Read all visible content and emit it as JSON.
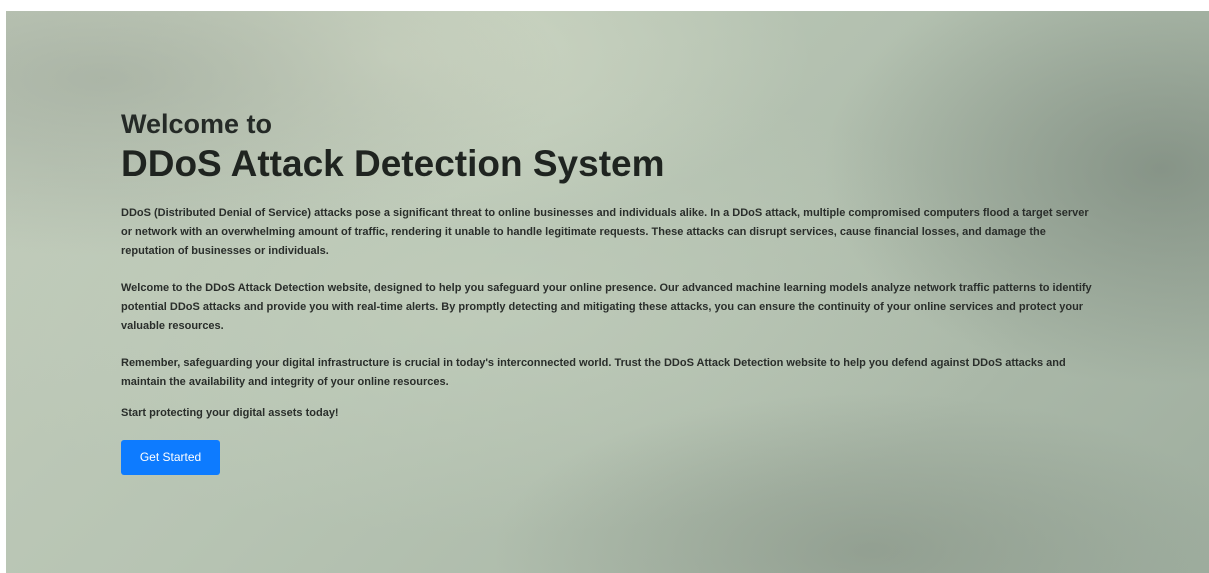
{
  "hero": {
    "welcome": "Welcome to",
    "title": "DDoS Attack Detection System",
    "paragraphs": [
      "DDoS (Distributed Denial of Service) attacks pose a significant threat to online businesses and individuals alike. In a DDoS attack, multiple compromised computers flood a target server or network with an overwhelming amount of traffic, rendering it unable to handle legitimate requests. These attacks can disrupt services, cause financial losses, and damage the reputation of businesses or individuals.",
      "Welcome to the DDoS Attack Detection website, designed to help you safeguard your online presence. Our advanced machine learning models analyze network traffic patterns to identify potential DDoS attacks and provide you with real-time alerts. By promptly detecting and mitigating these attacks, you can ensure the continuity of your online services and protect your valuable resources.",
      "Remember, safeguarding your digital infrastructure is crucial in today's interconnected world. Trust the DDoS Attack Detection website to help you defend against DDoS attacks and maintain the availability and integrity of your online resources.",
      "Start protecting your digital assets today!"
    ],
    "cta_label": "Get Started"
  },
  "colors": {
    "accent": "#0d7bff",
    "text": "#222622",
    "background": "#b7c4b3"
  }
}
